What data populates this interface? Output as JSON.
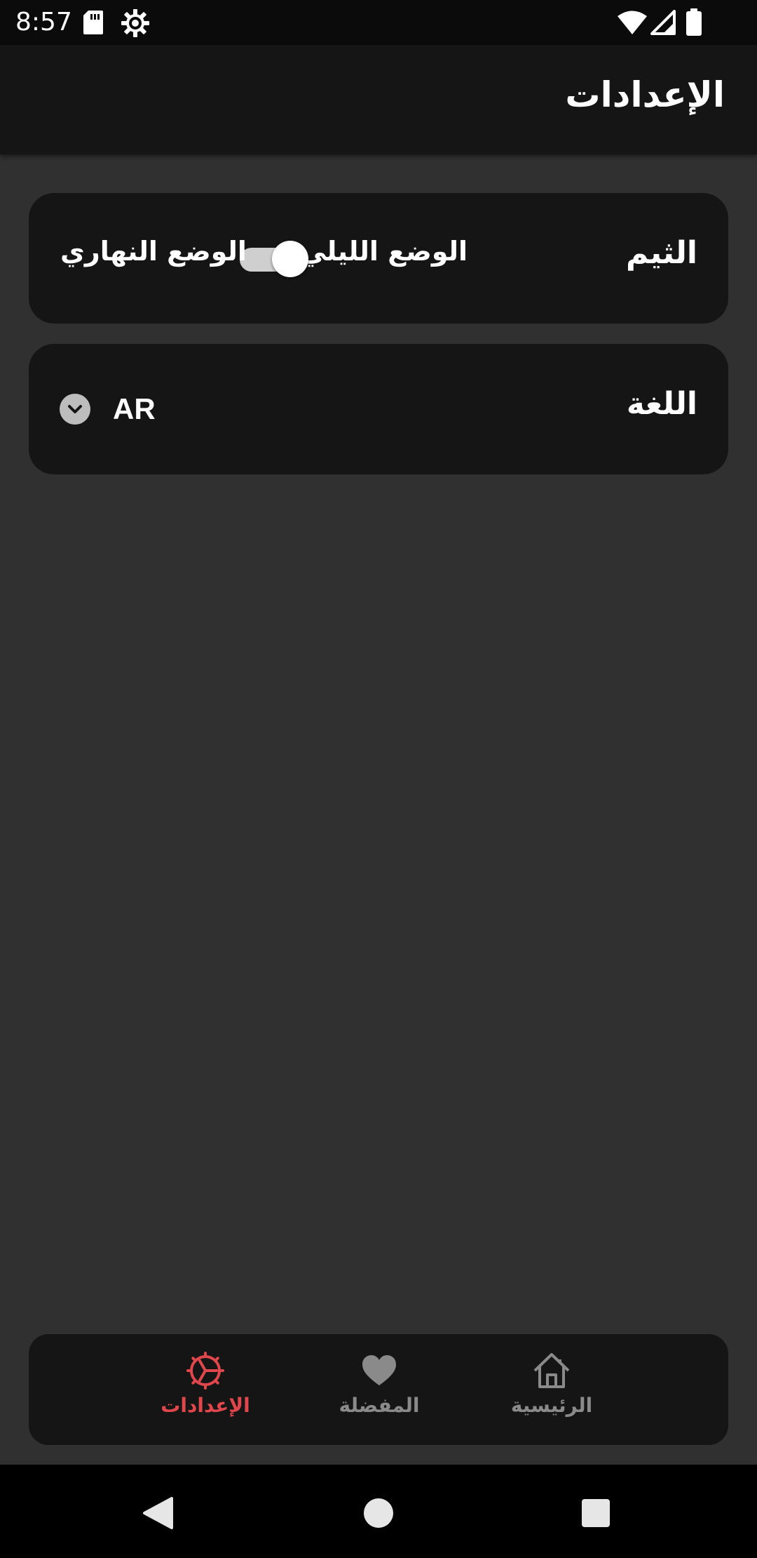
{
  "status_bar": {
    "time": "8:57",
    "icons": [
      "sd-card-icon",
      "settings-gear-icon",
      "wifi-icon",
      "cell-signal-icon",
      "battery-icon"
    ]
  },
  "app_bar": {
    "title": "الإعدادات"
  },
  "theme_card": {
    "label": "الثيم",
    "night_mode_label": "الوضع الليلي",
    "day_mode_label": "الوضع النهاري",
    "toggle_on": true
  },
  "language_card": {
    "label": "اللغة",
    "selected_language": "AR",
    "dropdown_icon": "chevron-down-icon"
  },
  "bottom_nav": {
    "items": [
      {
        "label": "الإعدادات",
        "icon": "settings-icon",
        "active": true
      },
      {
        "label": "المفضلة",
        "icon": "heart-icon",
        "active": false
      },
      {
        "label": "الرئيسية",
        "icon": "home-icon",
        "active": false
      }
    ]
  },
  "colors": {
    "background": "#303030",
    "card": "#151515",
    "active_nav": "#e0474c",
    "inactive_nav": "#8a8a8a",
    "status_bar": "#0b0b0b",
    "system_nav": "#000000"
  }
}
